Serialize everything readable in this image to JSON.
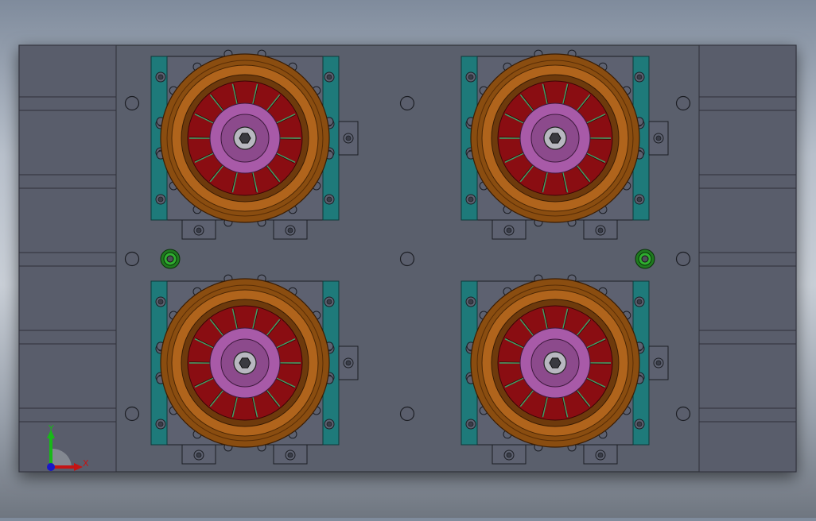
{
  "viewport": {
    "background_top": "#7f8b9c",
    "background_mid": "#c9cfd7",
    "background_bottom": "#6f7680"
  },
  "colors": {
    "plate": "#5a5e6c",
    "plate_edge": "#2e3038",
    "side_panel": "#595d6b",
    "mount_block": "#5d6170",
    "rail": "#1e7a7a",
    "wheel_outer": "#8a4d10",
    "wheel_ring": "#b0641c",
    "wheel_inner": "#6e3a0c",
    "rotor": "#8a0d12",
    "rotor_slot": "#3aa56a",
    "hub": "#a85aa8",
    "hub_inner": "#8c4a8c",
    "shaft": "#b8b8c0",
    "bolt_hole": "#3a3d48",
    "green_fitting": "#2fae2f"
  },
  "model": {
    "wheels": [
      "wheel-top-left",
      "wheel-top-right",
      "wheel-bottom-left",
      "wheel-bottom-right"
    ],
    "fittings": [
      "fitting-left",
      "fitting-right"
    ]
  },
  "triad": {
    "x_label": "X",
    "y_label": "Y",
    "x_color": "#d01818",
    "y_color": "#18b818",
    "z_color": "#1818c8"
  }
}
